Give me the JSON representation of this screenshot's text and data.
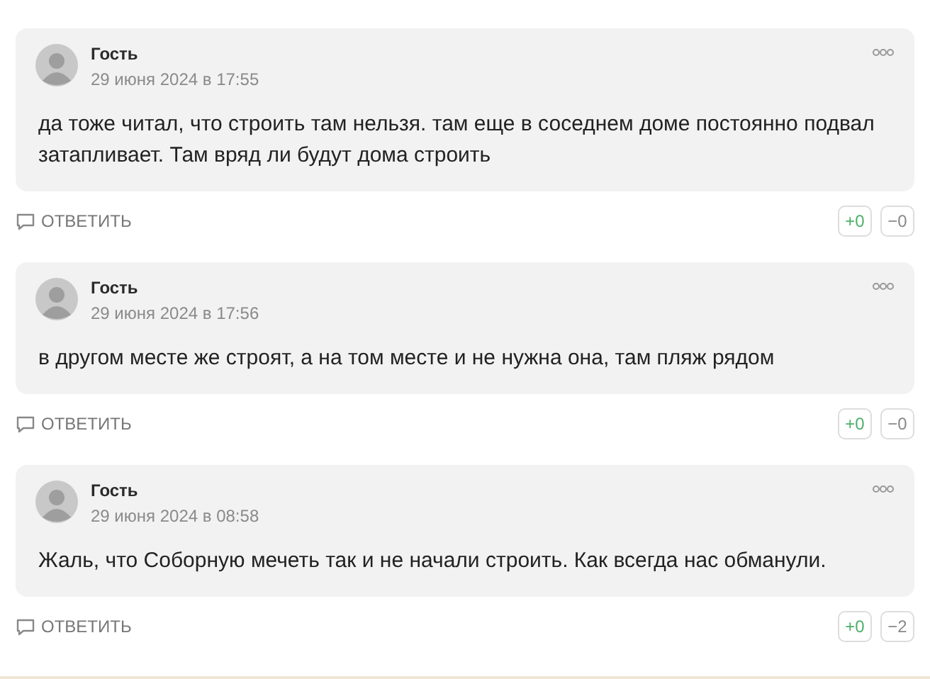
{
  "comments": [
    {
      "author": "Гость",
      "date": "29 июня 2024 в 17:55",
      "text": "да тоже читал, что строить там нельзя. там еще в соседнем доме постоянно подвал затапливает. Там вряд ли будут дома строить",
      "reply": "ОТВЕТИТЬ",
      "likes": "+0",
      "dislikes": "−0"
    },
    {
      "author": "Гость",
      "date": "29 июня 2024 в 17:56",
      "text": "в другом месте же строят, а на том месте и не нужна она, там пляж рядом",
      "reply": "ОТВЕТИТЬ",
      "likes": "+0",
      "dislikes": "−0"
    },
    {
      "author": "Гость",
      "date": "29 июня 2024 в 08:58",
      "text": "Жаль, что Соборную мечеть так и не начали строить. Как всегда нас обманули.",
      "reply": "ОТВЕТИТЬ",
      "likes": "+0",
      "dislikes": "−2"
    }
  ]
}
